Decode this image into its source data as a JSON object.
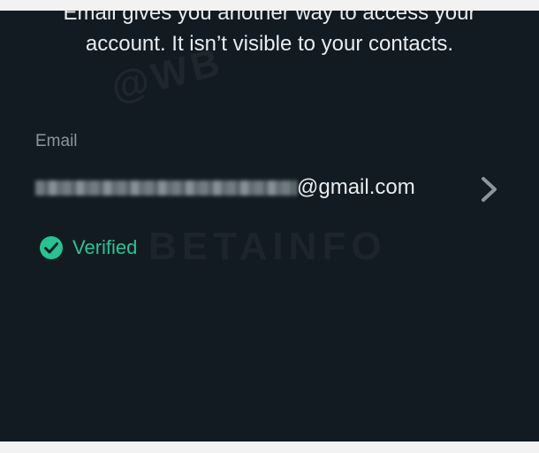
{
  "description": "Email gives you another way to access your account. It isn’t visible to your contacts.",
  "email": {
    "label": "Email",
    "local_part_redacted": true,
    "domain_suffix": "@gmail.com",
    "chevron_icon": "chevron-right-icon"
  },
  "verification": {
    "icon": "check-circle-icon",
    "label": "Verified"
  },
  "watermark": {
    "top": "@WB",
    "middle": "BETAINFO"
  },
  "colors": {
    "background": "#131b22",
    "text": "#e8ecee",
    "label": "#8a969e",
    "accent": "#25c493",
    "frame": "#f2f2f3"
  }
}
